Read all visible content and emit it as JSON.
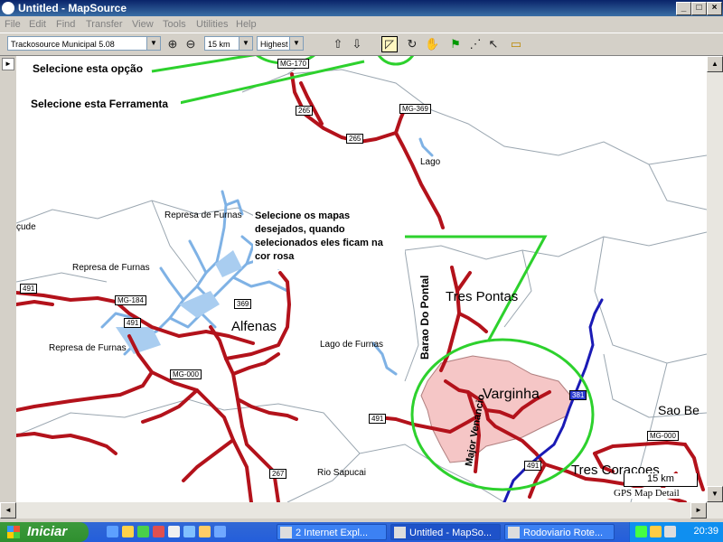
{
  "window": {
    "title": "Untitled - MapSource"
  },
  "menu": [
    "File",
    "Edit",
    "Find",
    "Transfer",
    "View",
    "Tools",
    "Utilities",
    "Help"
  ],
  "toolbar": {
    "map_product": "Trackosource Municipal 5.08",
    "zoom_level": "15 km",
    "detail": "Highest"
  },
  "annotations": {
    "select_option": "Selecione esta opção",
    "select_tool": "Selecione esta Ferramenta",
    "select_maps": [
      "Selecione os mapas",
      "desejados, quando",
      "selecionados eles ficam na",
      "cor rosa"
    ]
  },
  "map": {
    "scale_label": "15 km",
    "detail_label": "GPS Map Detail",
    "cities": {
      "alfenas": "Alfenas",
      "tres_pontas": "Tres Pontas",
      "varginha": "Varginha",
      "tres_coracoes": "Tres Coracoes",
      "sao_be": "Sao Be"
    },
    "labels": {
      "represa1": "Represa de Furnas",
      "represa2": "Represa de Furnas",
      "represa3": "Represa de Furnas",
      "lago": "Lago",
      "lago_furnas": "Lago de Furnas",
      "rio_sapucai": "Rio Sapucai",
      "acude": "çude",
      "barao": "Barao Do Pontal",
      "major": "Major Venancio"
    },
    "shields": {
      "mg170": "MG-170",
      "mg369": "MG-369",
      "mg184": "MG-184",
      "mg000a": "MG-000",
      "mg000b": "MG-000",
      "r265a": "265",
      "r265b": "265",
      "r369": "369",
      "r491a": "491",
      "r491b": "491",
      "r491c": "491",
      "r491d": "491",
      "r267": "267",
      "r381": "381"
    }
  },
  "taskbar": {
    "start": "Iniciar",
    "tasks": [
      "2 Internet Expl...",
      "Untitled - MapSo...",
      "Rodoviario Rote..."
    ],
    "clock": "20:39"
  }
}
